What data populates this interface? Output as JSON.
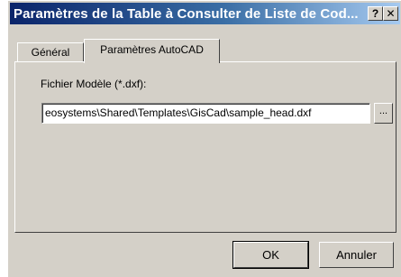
{
  "window": {
    "title": "Paramètres de la Table à Consulter de Liste de Cod...",
    "help_label": "?",
    "close_label": "✕"
  },
  "tabs": [
    {
      "label": "Général",
      "active": false
    },
    {
      "label": "Paramètres AutoCAD",
      "active": true
    }
  ],
  "panel": {
    "field_label": "Fichier Modèle (*.dxf):",
    "file_path": "eosystems\\Shared\\Templates\\GisCad\\sample_head.dxf",
    "browse_label": "..."
  },
  "buttons": {
    "ok_label": "OK",
    "cancel_label": "Annuler"
  }
}
